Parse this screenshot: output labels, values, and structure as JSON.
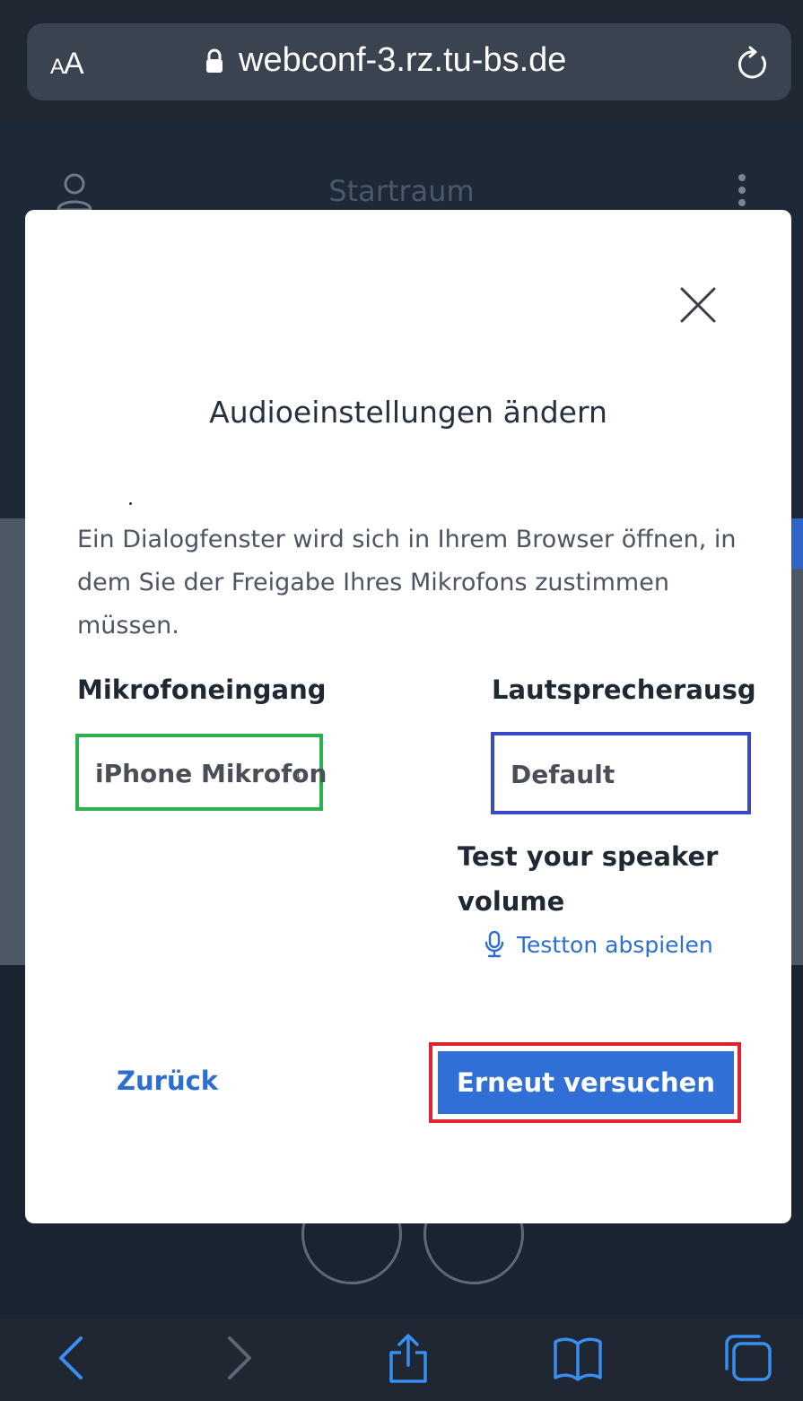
{
  "browser": {
    "aa_label_small": "A",
    "aa_label_large": "A",
    "url": "webconf-3.rz.tu-bs.de",
    "icons": [
      "lock-icon",
      "reload-icon"
    ],
    "toolbar_icons": [
      "back-icon",
      "forward-icon",
      "share-icon",
      "bookmarks-icon",
      "tabs-icon"
    ]
  },
  "app": {
    "room_title": "Startraum",
    "icons": [
      "user-icon",
      "kebab-menu-icon",
      "mic-off-icon",
      "camera-off-icon"
    ]
  },
  "modal": {
    "title": "Audioeinstellungen ändern",
    "description": "Ein Dialogfenster wird sich in Ihrem Browser öffnen, in dem Sie der Freigabe Ihres Mikrofons zustimmen müssen.",
    "mic_label": "Mikrofoneingang",
    "mic_value": "iPhone Mikrofon",
    "speaker_label": "Lautsprecherausgabe",
    "speaker_value": "Default",
    "test_title": "Test your speaker volume",
    "test_link": "Testton abspielen",
    "back_label": "Zurück",
    "retry_label": "Erneut versuchen"
  },
  "colors": {
    "accent_blue": "#2f6fd6",
    "highlight_green": "#2fb050",
    "highlight_blue": "#3748c8",
    "highlight_red": "#e0242f"
  }
}
